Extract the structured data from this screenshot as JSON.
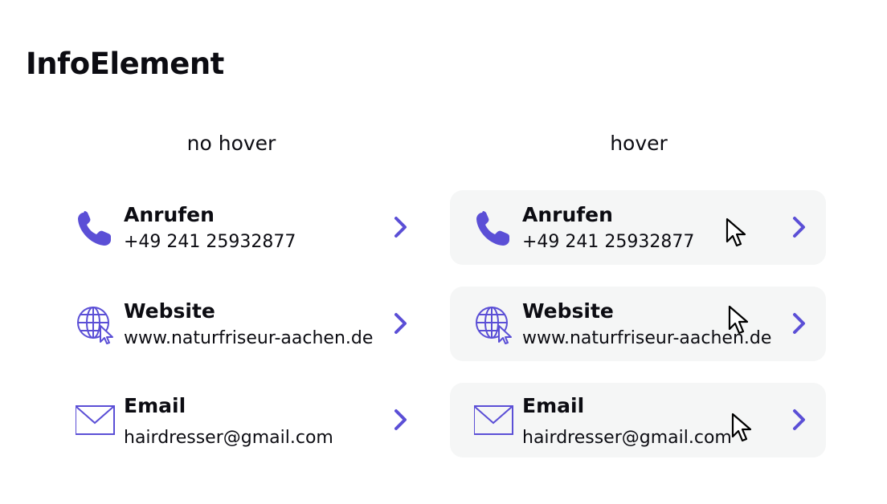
{
  "title": "InfoElement",
  "columns": {
    "left": "no hover",
    "right": "hover"
  },
  "accent_color": "#5b4fd6",
  "items": [
    {
      "label": "Anrufen",
      "value": "+49 241 25932877",
      "icon": "phone-icon"
    },
    {
      "label": "Website",
      "value": "www.naturfriseur-aachen.de",
      "icon": "globe-cursor-icon"
    },
    {
      "label": "Email",
      "value": "hairdresser@gmail.com",
      "icon": "mail-icon"
    }
  ]
}
